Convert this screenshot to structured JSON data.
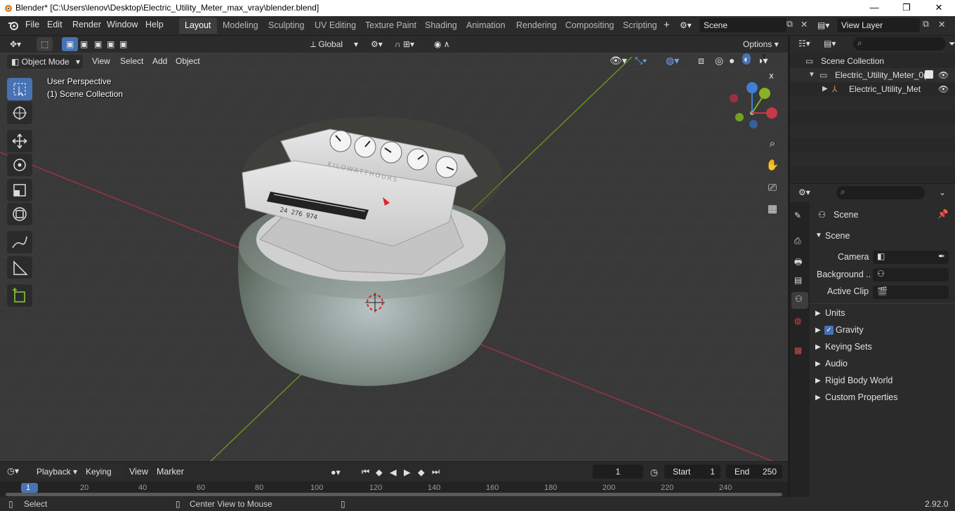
{
  "window": {
    "title": "Blender* [C:\\Users\\lenov\\Desktop\\Electric_Utility_Meter_max_vray\\blender.blend]",
    "minimize": "—",
    "maximize": "❐",
    "close": "✕"
  },
  "menu": {
    "file": "File",
    "edit": "Edit",
    "render": "Render",
    "window": "Window",
    "help": "Help"
  },
  "workspaces": [
    "Layout",
    "Modeling",
    "Sculpting",
    "UV Editing",
    "Texture Paint",
    "Shading",
    "Animation",
    "Rendering",
    "Compositing",
    "Scripting"
  ],
  "active_workspace": "Layout",
  "scene_field": "Scene",
  "view_layer_field": "View Layer",
  "header_tools": {
    "transform_orientation": "Global",
    "options": "Options"
  },
  "viewport": {
    "mode": "Object Mode",
    "menus": [
      "View",
      "Select",
      "Add",
      "Object"
    ],
    "perspective": "User Perspective",
    "collection": "(1) Scene Collection",
    "gizmo": {
      "x": "X",
      "y": "Y",
      "z": "Z"
    }
  },
  "meter_text": {
    "kilowatthours": "KILOWATTHOURS",
    "serial": "24 276 974"
  },
  "outliner": {
    "root": "Scene Collection",
    "items": [
      "Electric_Utility_Meter_0(",
      "Electric_Utility_Mete"
    ]
  },
  "properties": {
    "header": "Scene",
    "panel": "Scene",
    "camera_label": "Camera",
    "background_label": "Background ...",
    "active_clip_label": "Active Clip",
    "sections": [
      "Units",
      "Gravity",
      "Keying Sets",
      "Audio",
      "Rigid Body World",
      "Custom Properties"
    ],
    "gravity_checked": true
  },
  "timeline": {
    "menus": [
      "Playback",
      "Keying",
      "View",
      "Marker"
    ],
    "current_frame": "1",
    "start_label": "Start",
    "start_value": "1",
    "end_label": "End",
    "end_value": "250",
    "ruler": [
      "1",
      "20",
      "40",
      "60",
      "80",
      "100",
      "120",
      "140",
      "160",
      "180",
      "200",
      "220",
      "240"
    ]
  },
  "status": {
    "select": "Select",
    "center": "Center View to Mouse",
    "version": "2.92.0"
  },
  "colors": {
    "accent": "#4772b3",
    "x_axis": "#c6394a",
    "y_axis": "#86b321",
    "z_axis": "#3f7fd6"
  }
}
